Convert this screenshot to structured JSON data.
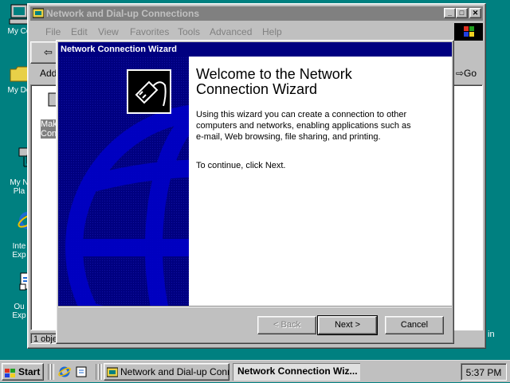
{
  "desktop": {
    "icons": [
      {
        "name": "my-computer",
        "label": "My Co"
      },
      {
        "name": "my-documents",
        "label": "My Do"
      },
      {
        "name": "my-network-places",
        "label": "My N\nPla"
      },
      {
        "name": "internet-explorer",
        "label": "Inte\nExp"
      },
      {
        "name": "outlook-express",
        "label": "Ou\nExp"
      }
    ]
  },
  "explorer": {
    "title": "Network and Dial-up Connections",
    "menu": [
      "File",
      "Edit",
      "View",
      "Favorites",
      "Tools",
      "Advanced",
      "Help"
    ],
    "toolbar_add": "Add",
    "go_label": "Go",
    "list_item_label": "Mak\nCon",
    "status_text": "1 obje",
    "status_right": "in"
  },
  "wizard": {
    "title": "Network Connection Wizard",
    "heading": "Welcome to the Network Connection Wizard",
    "body": "Using this wizard you can create a connection to other computers and networks, enabling applications such as e-mail, Web browsing, file sharing, and printing.",
    "continue_text": "To continue, click Next.",
    "buttons": {
      "back": "< Back",
      "next": "Next >",
      "cancel": "Cancel"
    }
  },
  "taskbar": {
    "start_label": "Start",
    "tasks": [
      "Network and Dial-up Conn...",
      "Network Connection Wiz..."
    ],
    "clock": "5:37 PM"
  },
  "colors": {
    "desktop": "#008080",
    "active_title": "#000080",
    "inactive_title": "#808080",
    "face": "#c0c0c0"
  }
}
